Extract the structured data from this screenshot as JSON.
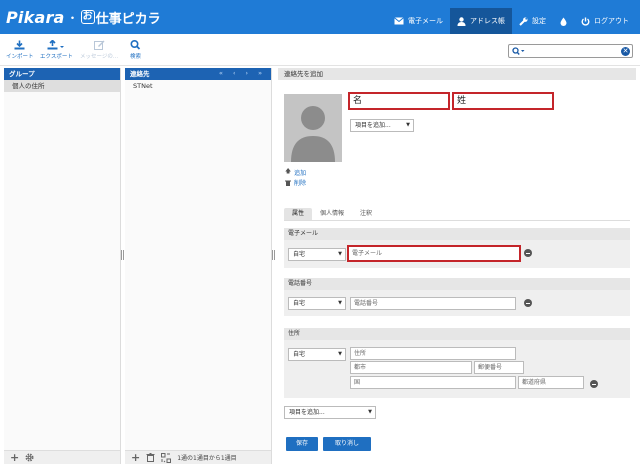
{
  "header": {
    "logo_text": "Pikara",
    "logo_sep": "・",
    "logo_o": "お",
    "service_name": "仕事ピカラ",
    "nav": {
      "email": "電子メール",
      "addressbook": "アドレス帳",
      "settings": "設定",
      "logout": "ログアウト"
    }
  },
  "toolbar": {
    "import": "インポート",
    "export": "エクスポート",
    "message": "メッセージの...",
    "search": "検索"
  },
  "groups": {
    "header": "グループ",
    "items": [
      "個人の住所"
    ]
  },
  "contacts": {
    "header": "連絡先",
    "pager": "« ‹ › »",
    "items": [
      "STNet"
    ],
    "count_text": "1通の1通目から1通目"
  },
  "detail": {
    "header": "連絡先を追加",
    "first_name": "名",
    "last_name": "姓",
    "add_field_select": "項目を追加...",
    "photo_add": "追加",
    "photo_delete": "削除",
    "tabs": [
      "属性",
      "個人情報",
      "注釈"
    ],
    "email_section": {
      "title": "電子メール",
      "type": "自宅",
      "placeholder": "電子メール"
    },
    "phone_section": {
      "title": "電話番号",
      "type": "自宅",
      "placeholder": "電話番号"
    },
    "address_section": {
      "title": "住所",
      "type": "自宅",
      "street": "住所",
      "city": "都市",
      "zip": "郵便番号",
      "country": "国",
      "prefecture": "都道府県"
    },
    "bottom_add_select": "項目を追加...",
    "save_button": "保存",
    "cancel_button": "取り消し"
  },
  "colors": {
    "header_blue": "#1f7bd6",
    "header_active": "#15569a",
    "accent_blue": "#1f6fc1",
    "highlight_red": "#c4252a"
  }
}
